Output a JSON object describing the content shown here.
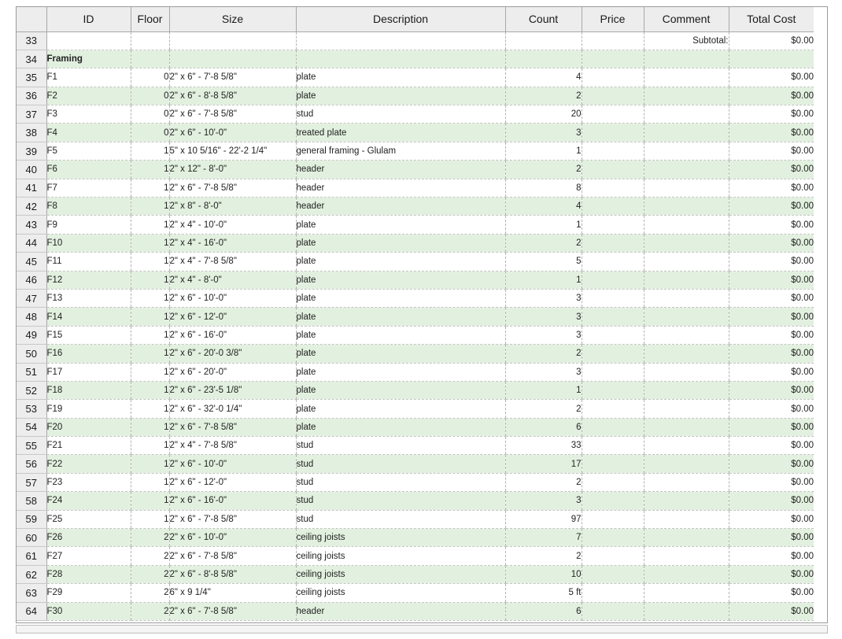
{
  "columns": [
    "",
    "ID",
    "Floor",
    "Size",
    "Description",
    "Count",
    "Price",
    "Comment",
    "Total Cost"
  ],
  "rows": [
    {
      "num": "33",
      "shade": false,
      "cells": [
        "",
        "",
        "",
        "",
        "",
        "",
        "Subtotal:",
        "$0.00"
      ]
    },
    {
      "num": "34",
      "shade": true,
      "section": true,
      "cells": [
        "Framing",
        "",
        "",
        "",
        "",
        "",
        "",
        ""
      ]
    },
    {
      "num": "35",
      "shade": false,
      "cells": [
        "F1",
        "0",
        "2\" x 6\" - 7'-8 5/8\"",
        "plate",
        "4",
        "",
        "",
        "$0.00"
      ]
    },
    {
      "num": "36",
      "shade": true,
      "cells": [
        "F2",
        "0",
        "2\" x 6\" - 8'-8 5/8\"",
        "plate",
        "2",
        "",
        "",
        "$0.00"
      ]
    },
    {
      "num": "37",
      "shade": false,
      "cells": [
        "F3",
        "0",
        "2\" x 6\" - 7'-8 5/8\"",
        "stud",
        "20",
        "",
        "",
        "$0.00"
      ]
    },
    {
      "num": "38",
      "shade": true,
      "cells": [
        "F4",
        "0",
        "2\" x 6\" - 10'-0\"",
        "treated plate",
        "3",
        "",
        "",
        "$0.00"
      ]
    },
    {
      "num": "39",
      "shade": false,
      "cells": [
        "F5",
        "1",
        "5\" x 10 5/16\" - 22'-2 1/4\"",
        "general framing - Glulam",
        "1",
        "",
        "",
        "$0.00"
      ]
    },
    {
      "num": "40",
      "shade": true,
      "cells": [
        "F6",
        "1",
        "2\" x 12\" - 8'-0\"",
        "header",
        "2",
        "",
        "",
        "$0.00"
      ]
    },
    {
      "num": "41",
      "shade": false,
      "cells": [
        "F7",
        "1",
        "2\" x 6\" - 7'-8 5/8\"",
        "header",
        "8",
        "",
        "",
        "$0.00"
      ]
    },
    {
      "num": "42",
      "shade": true,
      "cells": [
        "F8",
        "1",
        "2\" x 8\" - 8'-0\"",
        "header",
        "4",
        "",
        "",
        "$0.00"
      ]
    },
    {
      "num": "43",
      "shade": false,
      "cells": [
        "F9",
        "1",
        "2\" x 4\" - 10'-0\"",
        "plate",
        "1",
        "",
        "",
        "$0.00"
      ]
    },
    {
      "num": "44",
      "shade": true,
      "cells": [
        "F10",
        "1",
        "2\" x 4\" - 16'-0\"",
        "plate",
        "2",
        "",
        "",
        "$0.00"
      ]
    },
    {
      "num": "45",
      "shade": false,
      "cells": [
        "F11",
        "1",
        "2\" x 4\" - 7'-8 5/8\"",
        "plate",
        "5",
        "",
        "",
        "$0.00"
      ]
    },
    {
      "num": "46",
      "shade": true,
      "cells": [
        "F12",
        "1",
        "2\" x 4\" - 8'-0\"",
        "plate",
        "1",
        "",
        "",
        "$0.00"
      ]
    },
    {
      "num": "47",
      "shade": false,
      "cells": [
        "F13",
        "1",
        "2\" x 6\" - 10'-0\"",
        "plate",
        "3",
        "",
        "",
        "$0.00"
      ]
    },
    {
      "num": "48",
      "shade": true,
      "cells": [
        "F14",
        "1",
        "2\" x 6\" - 12'-0\"",
        "plate",
        "3",
        "",
        "",
        "$0.00"
      ]
    },
    {
      "num": "49",
      "shade": false,
      "cells": [
        "F15",
        "1",
        "2\" x 6\" - 16'-0\"",
        "plate",
        "3",
        "",
        "",
        "$0.00"
      ]
    },
    {
      "num": "50",
      "shade": true,
      "cells": [
        "F16",
        "1",
        "2\" x 6\" - 20'-0 3/8\"",
        "plate",
        "2",
        "",
        "",
        "$0.00"
      ]
    },
    {
      "num": "51",
      "shade": false,
      "cells": [
        "F17",
        "1",
        "2\" x 6\" - 20'-0\"",
        "plate",
        "3",
        "",
        "",
        "$0.00"
      ]
    },
    {
      "num": "52",
      "shade": true,
      "cells": [
        "F18",
        "1",
        "2\" x 6\" - 23'-5 1/8\"",
        "plate",
        "1",
        "",
        "",
        "$0.00"
      ]
    },
    {
      "num": "53",
      "shade": false,
      "cells": [
        "F19",
        "1",
        "2\" x 6\" - 32'-0 1/4\"",
        "plate",
        "2",
        "",
        "",
        "$0.00"
      ]
    },
    {
      "num": "54",
      "shade": true,
      "cells": [
        "F20",
        "1",
        "2\" x 6\" - 7'-8 5/8\"",
        "plate",
        "6",
        "",
        "",
        "$0.00"
      ]
    },
    {
      "num": "55",
      "shade": false,
      "cells": [
        "F21",
        "1",
        "2\" x 4\" - 7'-8 5/8\"",
        "stud",
        "33",
        "",
        "",
        "$0.00"
      ]
    },
    {
      "num": "56",
      "shade": true,
      "cells": [
        "F22",
        "1",
        "2\" x 6\" - 10'-0\"",
        "stud",
        "17",
        "",
        "",
        "$0.00"
      ]
    },
    {
      "num": "57",
      "shade": false,
      "cells": [
        "F23",
        "1",
        "2\" x 6\" - 12'-0\"",
        "stud",
        "2",
        "",
        "",
        "$0.00"
      ]
    },
    {
      "num": "58",
      "shade": true,
      "cells": [
        "F24",
        "1",
        "2\" x 6\" - 16'-0\"",
        "stud",
        "3",
        "",
        "",
        "$0.00"
      ]
    },
    {
      "num": "59",
      "shade": false,
      "cells": [
        "F25",
        "1",
        "2\" x 6\" - 7'-8 5/8\"",
        "stud",
        "97",
        "",
        "",
        "$0.00"
      ]
    },
    {
      "num": "60",
      "shade": true,
      "cells": [
        "F26",
        "2",
        "2\" x 6\" - 10'-0\"",
        "ceiling joists",
        "7",
        "",
        "",
        "$0.00"
      ]
    },
    {
      "num": "61",
      "shade": false,
      "cells": [
        "F27",
        "2",
        "2\" x 6\" - 7'-8 5/8\"",
        "ceiling joists",
        "2",
        "",
        "",
        "$0.00"
      ]
    },
    {
      "num": "62",
      "shade": true,
      "cells": [
        "F28",
        "2",
        "2\" x 6\" - 8'-8 5/8\"",
        "ceiling joists",
        "10",
        "",
        "",
        "$0.00"
      ]
    },
    {
      "num": "63",
      "shade": false,
      "cells": [
        "F29",
        "2",
        "6\" x 9 1/4\"",
        "ceiling joists",
        "5 ft",
        "",
        "",
        "$0.00"
      ]
    },
    {
      "num": "64",
      "shade": true,
      "cells": [
        "F30",
        "2",
        "2\" x 6\" - 7'-8 5/8\"",
        "header",
        "6",
        "",
        "",
        "$0.00"
      ]
    }
  ],
  "colors": {
    "header_bg": "#ededed",
    "row_shade": "#e2f1df",
    "row_plain": "#ffffff",
    "grid_line": "#c4c4c4"
  }
}
